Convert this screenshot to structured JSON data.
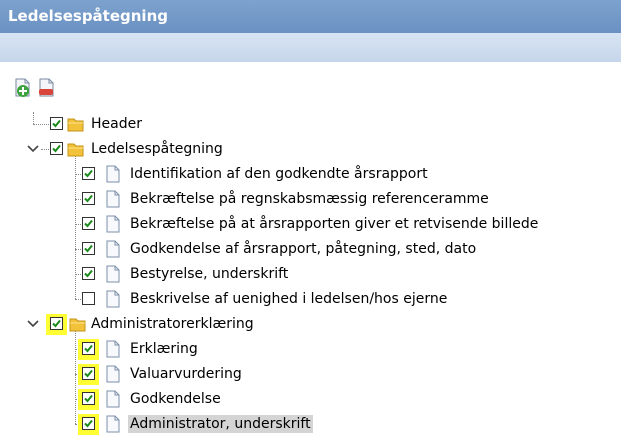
{
  "window": {
    "title": "Ledelsespåtegning"
  },
  "toolbar": {
    "add_icon": "document-add-icon",
    "remove_icon": "document-remove-icon"
  },
  "colors": {
    "titlebar": "#7098c8",
    "highlight": "#ffff33",
    "check": "#1a8a1a",
    "selected": "#d4d4d4"
  },
  "tree": {
    "nodes": [
      {
        "label": "Header",
        "checked": true
      },
      {
        "label": "Ledelsespåtegning",
        "checked": true,
        "expanded": true,
        "children": [
          {
            "label": "Identifikation af den godkendte årsrapport",
            "checked": true
          },
          {
            "label": "Bekræftelse på regnskabsmæssig referenceramme",
            "checked": true
          },
          {
            "label": "Bekræftelse på at årsrapporten giver et retvisende billede",
            "checked": true
          },
          {
            "label": "Godkendelse af årsrapport, påtegning, sted, dato",
            "checked": true
          },
          {
            "label": "Bestyrelse, underskrift",
            "checked": true
          },
          {
            "label": "Beskrivelse af uenighed i ledelsen/hos ejerne",
            "checked": false
          }
        ]
      },
      {
        "label": "Administratorerklæring",
        "checked": true,
        "expanded": true,
        "highlighted": true,
        "children": [
          {
            "label": "Erklæring",
            "checked": true,
            "highlighted": true
          },
          {
            "label": "Valuarvurdering",
            "checked": true,
            "highlighted": true
          },
          {
            "label": "Godkendelse",
            "checked": true,
            "highlighted": true
          },
          {
            "label": "Administrator, underskrift",
            "checked": true,
            "highlighted": true,
            "selected": true
          }
        ]
      }
    ]
  }
}
